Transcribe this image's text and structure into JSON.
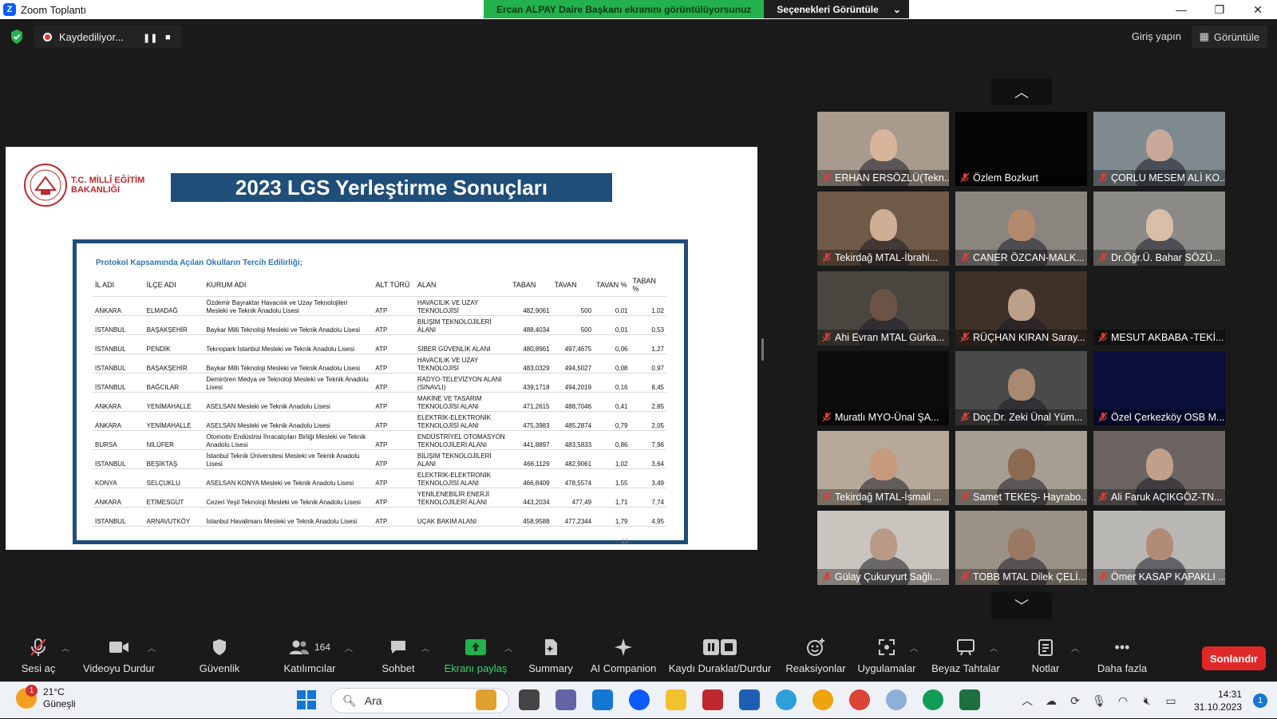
{
  "window": {
    "title": "Zoom Toplantı",
    "logo_letter": "Z",
    "share_status": "Ercan ALPAY Daire Başkanı ekranını görüntülüyorsunuz",
    "view_options": "Seçenekleri Görüntüle",
    "controls": [
      "—",
      "❐",
      "✕"
    ]
  },
  "topbar": {
    "recording_label": "Kaydediliyor...",
    "signin": "Giriş yapın",
    "view": "Görüntüle"
  },
  "slide": {
    "logo_text_line1": "T.C. MİLLÎ EĞİTİM",
    "logo_text_line2": "BAKANLIĞI",
    "title": "2023 LGS Yerleştirme Sonuçları",
    "caption": "Protokol Kapsamında Açılan Okulların Tercih Edilirliği;",
    "page_number": "13",
    "columns": [
      "İL ADI",
      "İLÇE ADI",
      "KURUM ADI",
      "ALT TÜRÜ",
      "ALAN",
      "TABAN",
      "TAVAN",
      "TAVAN %",
      "TABAN %"
    ],
    "rows": [
      [
        "ANKARA",
        "ELMADAĞ",
        "Özdemir Bayraktar Havacılık ve Uzay Teknolojileri Mesleki ve Teknik Anadolu Lisesi",
        "ATP",
        "HAVACILIK VE UZAY TEKNOLOJİSİ",
        "482,9061",
        "500",
        "0,01",
        "1,02"
      ],
      [
        "İSTANBUL",
        "BAŞAKŞEHİR",
        "Baykar Milli Teknoloji Mesleki ve Teknik Anadolu Lisesi",
        "ATP",
        "BİLİŞİM TEKNOLOJİLERİ ALANI",
        "488,4034",
        "500",
        "0,01",
        "0,53"
      ],
      [
        "İSTANBUL",
        "PENDİK",
        "Teknopark İstanbul Mesleki ve Teknik Anadolu Lisesi",
        "ATP",
        "SİBER GÜVENLİK ALANI",
        "480,8961",
        "497,4675",
        "0,06",
        "1,27"
      ],
      [
        "İSTANBUL",
        "BAŞAKŞEHİR",
        "Baykar Milli Teknoloji Mesleki ve Teknik Anadolu Lisesi",
        "ATP",
        "HAVACILIK VE UZAY TEKNOLOJİSİ",
        "483,0329",
        "494,5027",
        "0,08",
        "0,97"
      ],
      [
        "İSTANBUL",
        "BAĞCILAR",
        "Demirören Medya ve Teknoloji Mesleki ve Teknik Anadolu Lisesi",
        "ATP",
        "RADYO-TELEVİZYON ALANI (SINAVLI)",
        "439,1718",
        "494,2019",
        "0,16",
        "8,45"
      ],
      [
        "ANKARA",
        "YENİMAHALLE",
        "ASELSAN Mesleki ve Teknik Anadolu Lisesi",
        "ATP",
        "MAKİNE VE TASARIM TEKNOLOJİSİ ALANI",
        "471,2615",
        "488,7046",
        "0,41",
        "2,85"
      ],
      [
        "ANKARA",
        "YENİMAHALLE",
        "ASELSAN Mesleki ve Teknik Anadolu Lisesi",
        "ATP",
        "ELEKTRİK-ELEKTRONİK TEKNOLOJİSİ ALANI",
        "475,3983",
        "485,2874",
        "0,79",
        "2,05"
      ],
      [
        "BURSA",
        "NİLÜFER",
        "Otomotiv Endüstrisi İhracatçıları Birliği Mesleki ve Teknik Anadolu Lisesi",
        "ATP",
        "ENDÜSTRİYEL OTOMASYON TEKNOLOJİLERİ ALANI",
        "441,8897",
        "483,5833",
        "0,86",
        "7,96"
      ],
      [
        "İSTANBUL",
        "BEŞİKTAŞ",
        "İstanbul Teknik Üniversitesi Mesleki ve Teknik Anadolu Lisesi",
        "ATP",
        "BİLİŞİM TEKNOLOJİLERİ ALANI",
        "466,1129",
        "482,9061",
        "1,02",
        "3,64"
      ],
      [
        "KONYA",
        "SELÇUKLU",
        "ASELSAN KONYA Mesleki ve Teknik Anadolu Lisesi",
        "ATP",
        "ELEKTRİK-ELEKTRONİK TEKNOLOJİSİ ALANI",
        "466,8409",
        "478,5574",
        "1,55",
        "3,49"
      ],
      [
        "ANKARA",
        "ETİMESGUT",
        "Cezeri Yeşil Teknoloji Mesleki ve Teknik Anadolu Lisesi",
        "ATP",
        "YENİLENEBİLİR ENERJİ TEKNOLOJİLERİ ALANI",
        "443,2034",
        "477,49",
        "1,71",
        "7,74"
      ],
      [
        "İSTANBUL",
        "ARNAVUTKÖY",
        "İstanbul Havalimanı Mesleki ve Teknik Anadolu Lisesi",
        "ATP",
        "UÇAK BAKIM ALANI",
        "458,9588",
        "477,2344",
        "1,79",
        "4,95"
      ]
    ]
  },
  "participants": [
    {
      "name": "ERHAN ERSÖZLÜ(Tekn...",
      "bg": "#a89a8c",
      "face": "#d8b59a"
    },
    {
      "name": "Özlem Bozkurt",
      "bg": "#050505",
      "face": ""
    },
    {
      "name": "ÇORLU MESEM ALİ KO...",
      "bg": "#7f8a8f",
      "face": "#c7a899"
    },
    {
      "name": "Tekirdağ MTAL-İbrahi...",
      "bg": "#6f5a48",
      "face": "#cfae96"
    },
    {
      "name": "CANER ÖZCAN-MALK...",
      "bg": "#8b8580",
      "face": "#b48a6e"
    },
    {
      "name": "Dr.Öğr.Ü. Bahar SÖZÜ...",
      "bg": "#8c8a86",
      "face": "#d9bfa8"
    },
    {
      "name": "Ahi Evran MTAL Gürka...",
      "bg": "#4b4540",
      "face": "#6b5446"
    },
    {
      "name": "RÜÇHAN KIRAN Saray...",
      "bg": "#3e3128",
      "face": "#bca08a"
    },
    {
      "name": "MESUT AKBABA -TEKİ...",
      "bg": "#1a1a1a",
      "face": ""
    },
    {
      "name": "Muratlı MYO-Ünal ŞA...",
      "bg": "#0e0b0b",
      "face": ""
    },
    {
      "name": "Doç.Dr. Zeki Ünal Yüm...",
      "bg": "#4a4a48",
      "face": "#a88a72"
    },
    {
      "name": "Özel Çerkezköy OSB M...",
      "bg": "#0a0e3a",
      "face": ""
    },
    {
      "name": "Tekirdağ MTAL-İsmail ...",
      "bg": "#b7a99a",
      "face": "#c59a7d"
    },
    {
      "name": "Samet TEKEŞ- Hayrabo...",
      "bg": "#a79e92",
      "face": "#8c6a52"
    },
    {
      "name": "Ali Faruk AÇIKGÖZ-TN...",
      "bg": "#6c6461",
      "face": "#c0a08a"
    },
    {
      "name": "Gülay Çukuryurt Sağlı...",
      "bg": "#c9c4bd",
      "face": "#b89a88"
    },
    {
      "name": "TOBB MTAL Dilek ÇELİ...",
      "bg": "#9c9186",
      "face": "#9a7864"
    },
    {
      "name": "Ömer KASAP KAPAKLI ...",
      "bg": "#b9b7b4",
      "face": "#b08c76"
    }
  ],
  "toolbar": {
    "audio": "Sesi aç",
    "video": "Videoyu Durdur",
    "security": "Güvenlik",
    "participants": "Katılımcılar",
    "participant_count": "164",
    "chat": "Sohbet",
    "share": "Ekranı paylaş",
    "summary": "Summary",
    "ai": "AI Companion",
    "record": "Kaydı Duraklat/Durdur",
    "reactions": "Reaksiyonlar",
    "apps": "Uygulamalar",
    "whiteboard": "Beyaz Tahtalar",
    "notes": "Notlar",
    "more": "Daha fazla",
    "end": "Sonlandır"
  },
  "taskbar": {
    "weather_temp": "21°C",
    "weather_desc": "Güneşli",
    "weather_badge": "1",
    "search_placeholder": "Ara",
    "time": "14:31",
    "date": "31.10.2023",
    "notif_count": "1"
  },
  "colors": {
    "zoom_blue": "#0b5cff",
    "share_green": "#22b14c",
    "slide_navy": "#1f4e79",
    "end_red": "#e02828"
  }
}
